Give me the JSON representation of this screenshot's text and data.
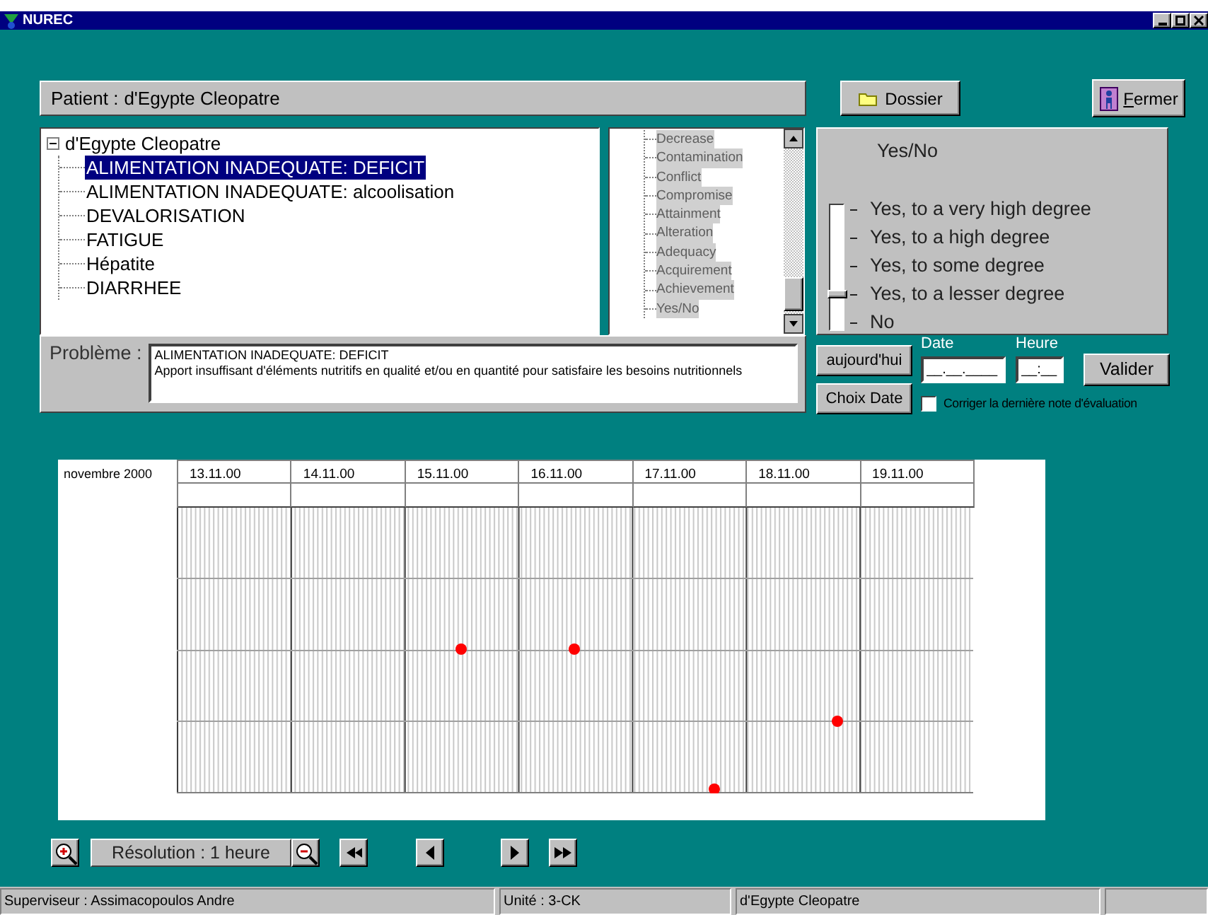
{
  "window": {
    "title": "NUREC"
  },
  "patient": {
    "label": "Patient :",
    "name": "d'Egypte Cleopatre"
  },
  "header_buttons": [
    {
      "kind": "folder",
      "label": "Dossier"
    },
    {
      "kind": "exit",
      "label": "Fermer"
    }
  ],
  "tree": {
    "label": "d'Egypte Cleopatre",
    "expanded": true,
    "children": [
      {
        "label": "ALIMENTATION INADEQUATE: DEFICIT",
        "selected": true
      },
      {
        "label": "ALIMENTATION INADEQUATE: alcoolisation",
        "selected": false
      },
      {
        "label": "DEVALORISATION",
        "selected": false
      },
      {
        "label": "FATIGUE",
        "selected": false
      },
      {
        "label": "Hépatite",
        "selected": false
      },
      {
        "label": "DIARRHEE",
        "selected": false
      }
    ]
  },
  "indicator_list": {
    "items": [
      {
        "label": "Decrease",
        "disabled": true
      },
      {
        "label": "Contamination",
        "disabled": true
      },
      {
        "label": "Conflict",
        "disabled": true
      },
      {
        "label": "Compromise",
        "disabled": true
      },
      {
        "label": "Attainment",
        "disabled": true
      },
      {
        "label": "Alteration",
        "disabled": true
      },
      {
        "label": "Adequacy",
        "disabled": true
      },
      {
        "label": "Acquirement",
        "disabled": true
      },
      {
        "label": "Achievement",
        "disabled": true
      },
      {
        "label": "Yes/No",
        "disabled": true
      }
    ]
  },
  "scale": {
    "title": "Yes/No",
    "level": 0.25,
    "options": [
      "Yes, to a very high degree",
      "Yes, to a high degree",
      "Yes, to some degree",
      "Yes, to a lesser degree",
      "No"
    ]
  },
  "problem": {
    "label": "Problème :",
    "title": "ALIMENTATION INADEQUATE: DEFICIT",
    "description": "Apport insuffisant d'éléments nutritifs en qualité et/ou en quantité pour satisfaire les besoins nutritionnels"
  },
  "date_controls": {
    "today_button": "aujourd'hui",
    "choose_date_button": "Choix Date",
    "date_label": "Date",
    "date_value": "__.__.____",
    "time_label": "Heure",
    "time_value": "__:__",
    "validate_button": "Valider",
    "correct_last": {
      "label": "Corriger la dernière note d'évaluation",
      "checked": false
    }
  },
  "chart": {
    "month": "novembre 2000",
    "dates": [
      "13.11.00",
      "14.11.00",
      "15.11.00",
      "16.11.00",
      "17.11.00",
      "18.11.00",
      "19.11.00"
    ]
  },
  "toolbar": {
    "resolution": "Résolution : 1 heure"
  },
  "status_bar": [
    "Superviseur : Assimacopoulos Andre",
    "Unité : 3-CK",
    "d'Egypte Cleopatre"
  ]
}
